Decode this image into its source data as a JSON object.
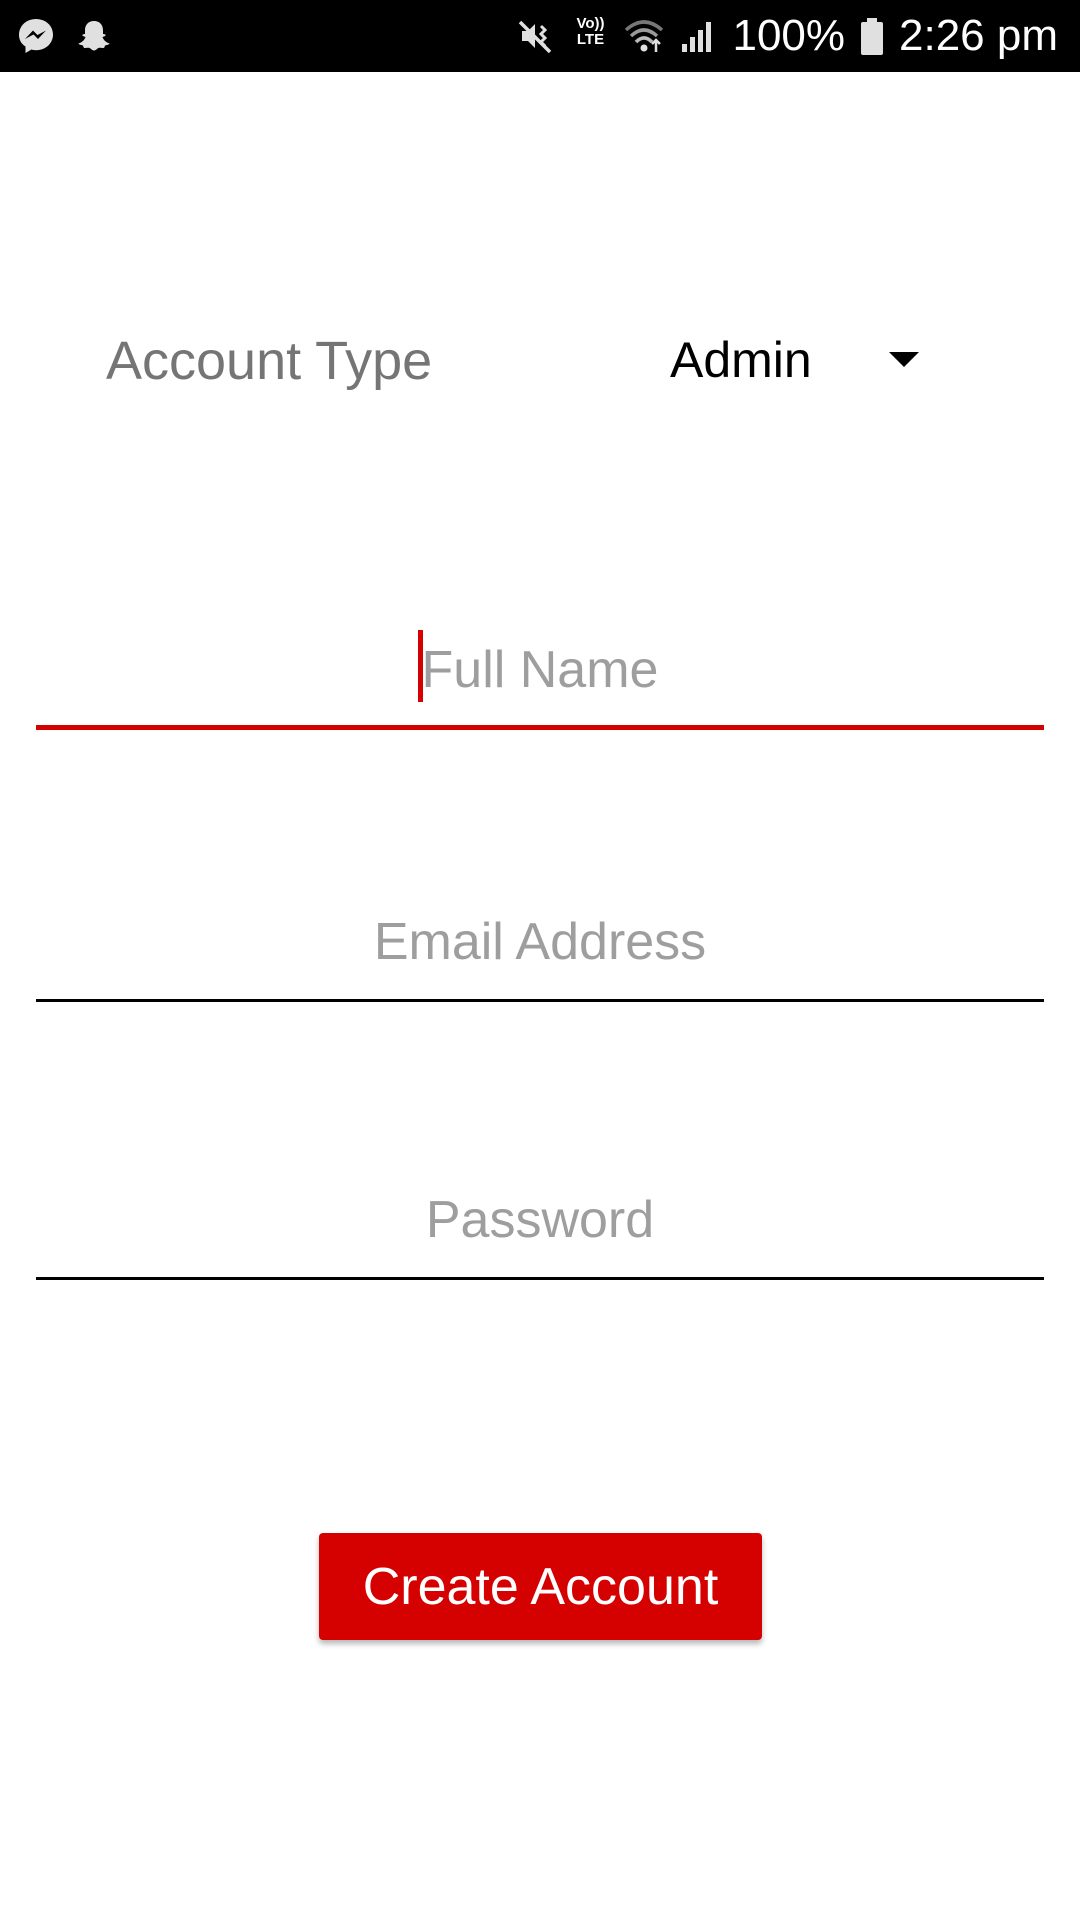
{
  "status_bar": {
    "battery": "100%",
    "time": "2:26 pm",
    "volte_top": "Vo))",
    "volte_bottom": "LTE",
    "icons_left": [
      "messenger-icon",
      "snapchat-icon"
    ],
    "icons_right": [
      "vibrate-mute-icon",
      "volte-icon",
      "wifi-icon",
      "cell-signal-icon",
      "battery-icon"
    ]
  },
  "form": {
    "account_type_label": "Account Type",
    "account_type_value": "Admin",
    "full_name_placeholder": "Full Name",
    "email_placeholder": "Email Address",
    "password_placeholder": "Password",
    "create_button_label": "Create Account"
  },
  "colors": {
    "accent": "#d50000",
    "status_bar_bg": "#000000",
    "label_text": "#757575",
    "placeholder_text": "#9e9e9e"
  }
}
